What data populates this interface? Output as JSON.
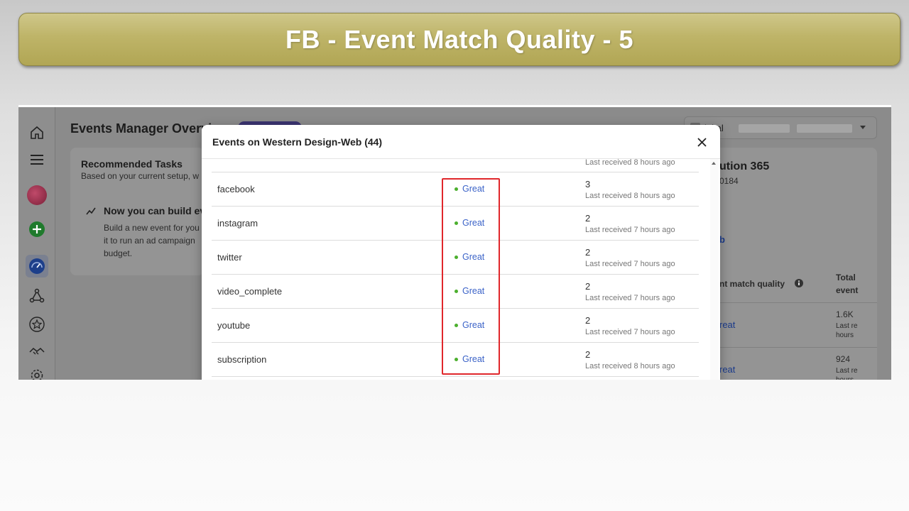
{
  "banner": {
    "title": "FB - Event Match Quality - 5"
  },
  "background": {
    "page_title": "Events Manager Overvi",
    "tasks_title": "Recommended Tasks",
    "tasks_subtitle": "Based on your current setup, w",
    "tip_title": "Now you can build ev",
    "tip_line1": "Build a new event for you",
    "tip_line2": "it to run an ad campaign",
    "tip_line3": "budget.",
    "account_label": "igital",
    "right_title": "ution 365",
    "right_sub": "0184",
    "right_link": "b",
    "col_match_quality": "nt match quality",
    "col_total": "Total",
    "col_events": "event",
    "rows": [
      {
        "quality": "reat",
        "total": "1.6K",
        "last1": "Last re",
        "last2": "hours"
      },
      {
        "quality": "reat",
        "total": "924",
        "last1": "Last re",
        "last2": "hours"
      }
    ]
  },
  "modal": {
    "title": "Events on Western Design-Web (44)",
    "top_partial_last": "Last received 8 hours ago",
    "rows": [
      {
        "name": "facebook",
        "quality": "Great",
        "count": "3",
        "last": "Last received 8 hours ago"
      },
      {
        "name": "instagram",
        "quality": "Great",
        "count": "2",
        "last": "Last received 7 hours ago"
      },
      {
        "name": "twitter",
        "quality": "Great",
        "count": "2",
        "last": "Last received 7 hours ago"
      },
      {
        "name": "video_complete",
        "quality": "Great",
        "count": "2",
        "last": "Last received 7 hours ago"
      },
      {
        "name": "youtube",
        "quality": "Great",
        "count": "2",
        "last": "Last received 7 hours ago"
      },
      {
        "name": "subscription",
        "quality": "Great",
        "count": "2",
        "last": "Last received 8 hours ago"
      }
    ]
  },
  "colors": {
    "banner": "#beb468",
    "highlight": "#e0272b",
    "quality_link": "#3b63c8",
    "quality_dot": "#4caf2e"
  }
}
